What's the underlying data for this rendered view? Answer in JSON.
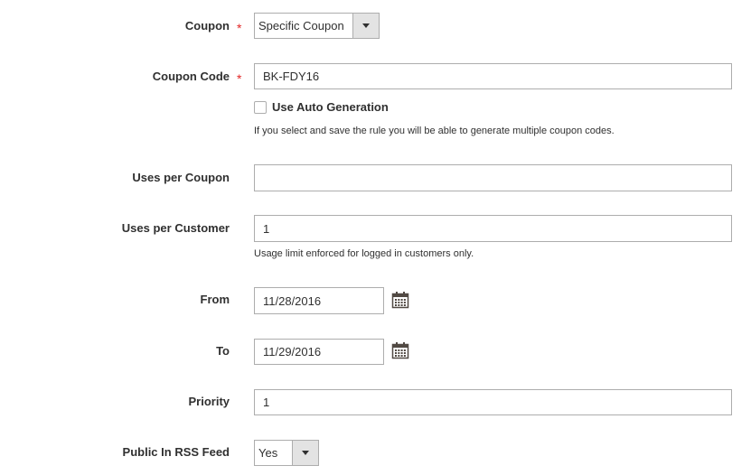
{
  "coupon": {
    "label": "Coupon",
    "required_mark": "*",
    "value": "Specific Coupon"
  },
  "coupon_code": {
    "label": "Coupon Code",
    "required_mark": "*",
    "value": "BK-FDY16"
  },
  "auto_generation": {
    "label": "Use Auto Generation",
    "checked": false,
    "note": "If you select and save the rule you will be able to generate multiple coupon codes."
  },
  "uses_per_coupon": {
    "label": "Uses per Coupon",
    "value": ""
  },
  "uses_per_customer": {
    "label": "Uses per Customer",
    "value": "1",
    "note": "Usage limit enforced for logged in customers only."
  },
  "from": {
    "label": "From",
    "value": "11/28/2016",
    "icon": "calendar-icon"
  },
  "to": {
    "label": "To",
    "value": "11/29/2016",
    "icon": "calendar-icon"
  },
  "priority": {
    "label": "Priority",
    "value": "1"
  },
  "rss_feed": {
    "label": "Public In RSS Feed",
    "value": "Yes"
  },
  "colors": {
    "required": "#e22626",
    "border": "#adadad",
    "select_arrow_bg": "#e3e3e3",
    "text": "#303030"
  }
}
